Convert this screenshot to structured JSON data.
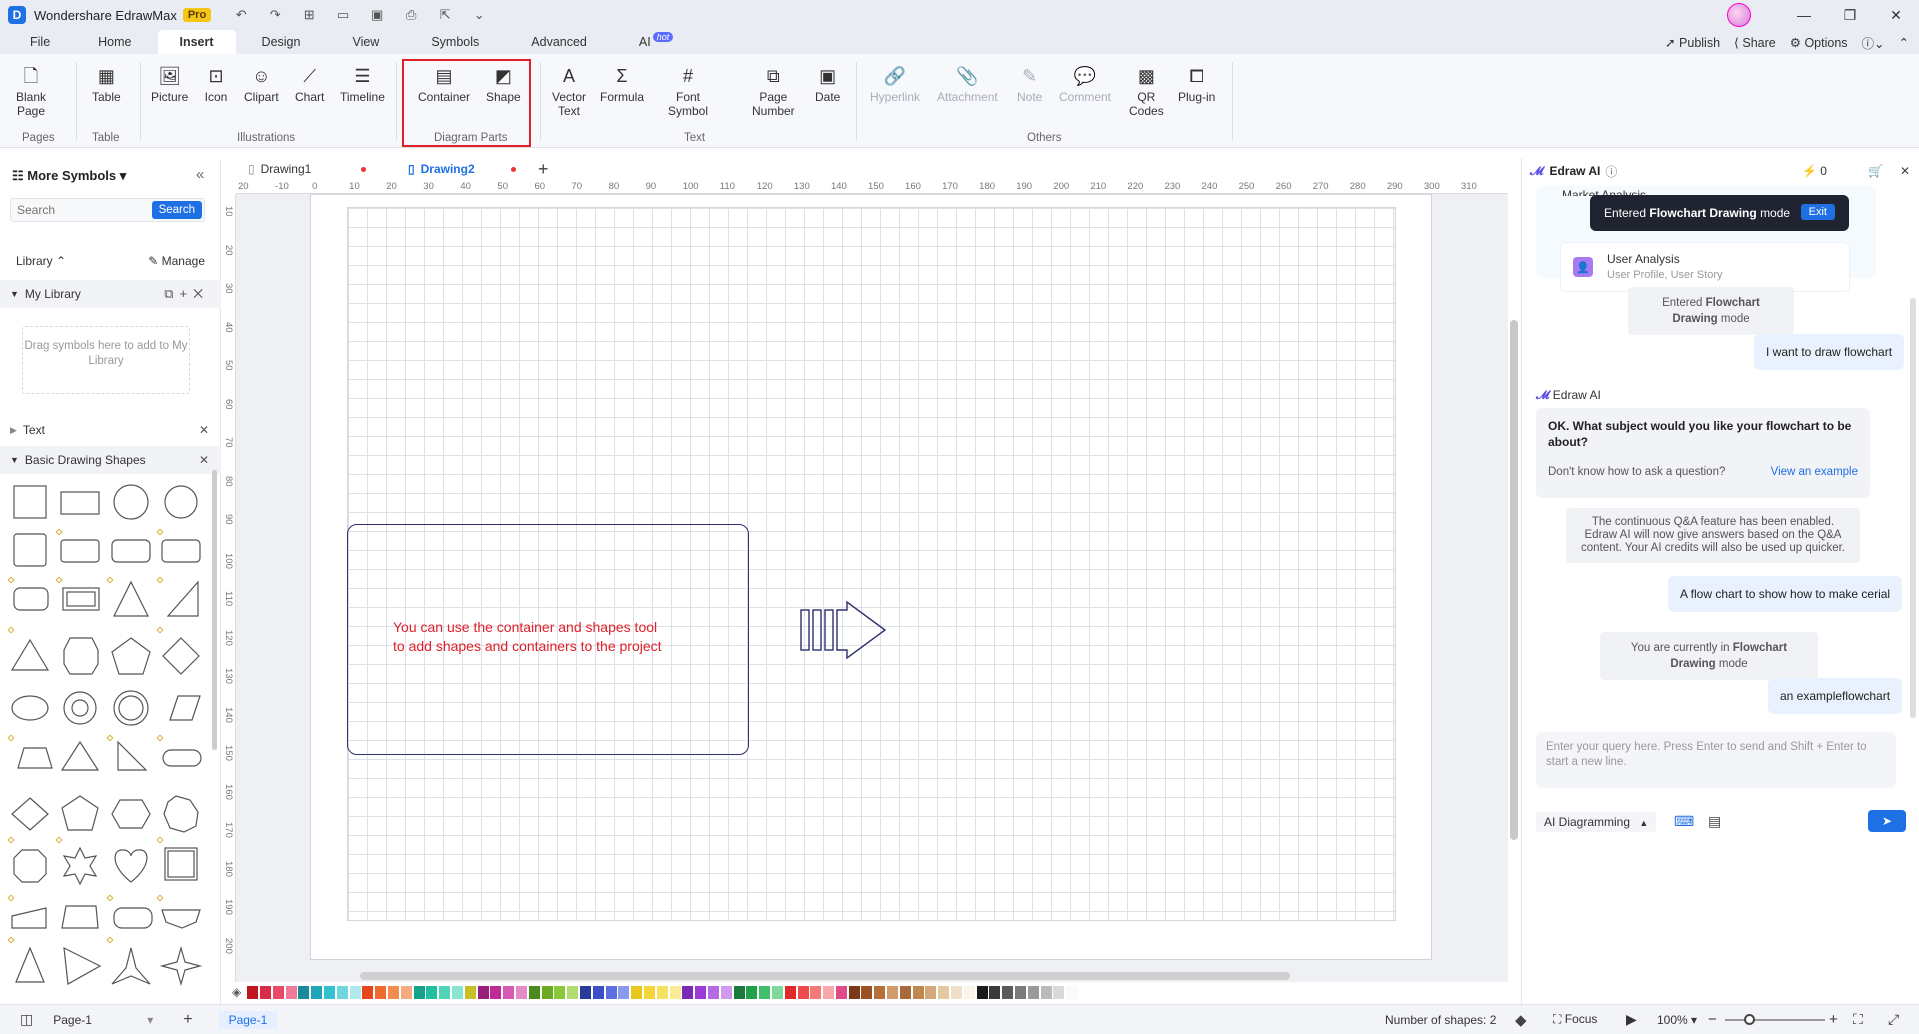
{
  "titlebar": {
    "app_name": "Wondershare EdrawMax",
    "pro_badge": "Pro"
  },
  "menu": {
    "tabs": [
      "File",
      "Home",
      "Insert",
      "Design",
      "View",
      "Symbols",
      "Advanced",
      "AI"
    ],
    "active": "Insert",
    "ai_badge": "hot",
    "right": {
      "publish": "Publish",
      "share": "Share",
      "options": "Options"
    }
  },
  "ribbon": {
    "blank_page": "Blank\nPage",
    "table": "Table",
    "picture": "Picture",
    "icon": "Icon",
    "clipart": "Clipart",
    "chart": "Chart",
    "timeline": "Timeline",
    "container": "Container",
    "shape": "Shape",
    "vector_text": "Vector\nText",
    "formula": "Formula",
    "font_symbol": "Font\nSymbol",
    "page_number": "Page\nNumber",
    "date": "Date",
    "hyperlink": "Hyperlink",
    "attachment": "Attachment",
    "note": "Note",
    "comment": "Comment",
    "qr_codes": "QR\nCodes",
    "plugin": "Plug-in",
    "groups": {
      "pages": "Pages",
      "table": "Table",
      "illustrations": "Illustrations",
      "diagram_parts": "Diagram Parts",
      "text": "Text",
      "others": "Others"
    }
  },
  "left_panel": {
    "title": "More Symbols",
    "search_placeholder": "Search",
    "search_button": "Search",
    "library_label": "Library",
    "manage_label": "Manage",
    "my_library": "My Library",
    "drop_hint": "Drag symbols here to add to My Library",
    "text_section": "Text",
    "basic_shapes_section": "Basic Drawing Shapes"
  },
  "doc_tabs": [
    {
      "label": "Drawing1",
      "active": false
    },
    {
      "label": "Drawing2",
      "active": true
    }
  ],
  "ruler": {
    "h_ticks": [
      "20",
      "-10",
      "0",
      "10",
      "20",
      "30",
      "40",
      "50",
      "60",
      "70",
      "80",
      "90",
      "100",
      "110",
      "120",
      "130",
      "140",
      "150",
      "160",
      "170",
      "180",
      "190",
      "200",
      "210",
      "220",
      "230",
      "240",
      "250",
      "260",
      "270",
      "280",
      "290",
      "300",
      "310"
    ],
    "v_ticks": [
      "10",
      "20",
      "30",
      "40",
      "50",
      "60",
      "70",
      "80",
      "90",
      "100",
      "110",
      "120",
      "130",
      "140",
      "150",
      "160",
      "170",
      "180",
      "190",
      "200"
    ]
  },
  "canvas": {
    "container_text_line1": "You can use the container and shapes tool",
    "container_text_line2": "to add shapes and containers to the project",
    "container_text_color": "#e0202a"
  },
  "colors": {
    "accent": "#1f6fe5",
    "highlight": "#e0202a",
    "swatches": [
      "#c0151f",
      "#d92a4a",
      "#e84a6a",
      "#f07a9a",
      "#1a8a9a",
      "#1fa6b8",
      "#34c0cf",
      "#6fd6df",
      "#b0e8ee",
      "#e8451f",
      "#f06a30",
      "#f58a50",
      "#f5ab80",
      "#14a38a",
      "#1fbf9f",
      "#4fd4b8",
      "#8ae5d0",
      "#c8c028",
      "#9a1f7a",
      "#c02a96",
      "#d65ab4",
      "#e48ac8",
      "#4a8a1a",
      "#6aaa20",
      "#8ac83a",
      "#b0dc70",
      "#2a3a9a",
      "#3a4fc8",
      "#5a6fe0",
      "#8a9aea",
      "#e8c81a",
      "#f5d53a",
      "#f8e060",
      "#faeb95",
      "#7a2ab4",
      "#9a3ad8",
      "#b46ae4",
      "#cf9aee",
      "#1a7a3a",
      "#20a04a",
      "#40c06a",
      "#80d89a",
      "#e02a2a",
      "#f04a4a",
      "#f47a7a",
      "#f8a8a8",
      "#e04a8a",
      "#7a3a1a",
      "#9a5020",
      "#b8703a",
      "#d09a6a",
      "#a86a3a",
      "#c08850",
      "#d4a878",
      "#e4c8a0",
      "#efe0c8",
      "#faf4ea",
      "#1a1a1a",
      "#3a3a3a",
      "#5a5a5a",
      "#7a7a7a",
      "#9a9a9a",
      "#bababa",
      "#dadada",
      "#fafafa"
    ]
  },
  "bottom": {
    "page_select": "Page-1",
    "page_tab": "Page-1",
    "shapes_count": "Number of shapes: 2",
    "focus": "Focus",
    "zoom": "100%"
  },
  "ai_panel": {
    "title": "Edraw AI",
    "credits": "0",
    "toast_text_prefix": "Entered ",
    "toast_text_bold": "Flowchart Drawing",
    "toast_text_suffix": " mode",
    "toast_exit": "Exit",
    "card_partial": "Market Analysis",
    "card_title": "User Analysis",
    "card_sub": "User Profile, User Story",
    "sys1_prefix": "Entered ",
    "sys1_bold": "Flowchart Drawing",
    "sys1_suffix": " mode",
    "user1": "I want to draw flowchart",
    "ai_name": "Edraw AI",
    "ai_msg": "OK. What subject would you like your flowchart to be about?",
    "ai_hint": "Don't know how to ask a question?",
    "ai_link": "View an example",
    "sys2": "The continuous Q&A feature has been enabled. Edraw AI will now give answers based on the Q&A content. Your AI credits will also be used up quicker.",
    "user2": "A flow chart to show how to make cerial",
    "sys3_prefix": "You are currently in ",
    "sys3_bold": "Flowchart Drawing",
    "sys3_suffix": " mode",
    "user3": "an exampleflowchart",
    "query_placeholder": "Enter your query here. Press Enter to send and Shift + Enter to start a new line.",
    "mode_select": "AI Diagramming"
  }
}
